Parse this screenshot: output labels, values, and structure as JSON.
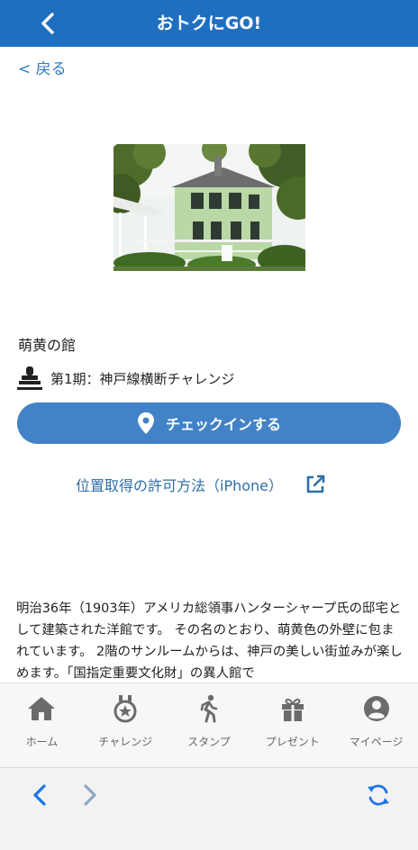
{
  "header": {
    "title": "おトクにGO!",
    "back_icon": "chevron-left-icon"
  },
  "back_link": {
    "label": "< 戻る"
  },
  "photo": {
    "icon": "house-photo"
  },
  "spot": {
    "name": "萌黄の館",
    "challenge_icon": "stamp-icon",
    "challenge": "第1期：神戸線横断チャレンジ"
  },
  "checkin": {
    "icon": "map-pin-icon",
    "label": "チェックインする"
  },
  "permission_link": {
    "label": "位置取得の許可方法（iPhone）",
    "icon": "external-link-icon"
  },
  "description": "明治36年（1903年）アメリカ総領事ハンターシャープ氏の邸宅として建築された洋館です。 その名のとおり、萌黄色の外壁に包まれています。 2階のサンルームからは、神戸の美しい街並みが楽しめます。「国指定重要文化財」の異人館で",
  "tabbar": {
    "items": [
      {
        "label": "ホーム",
        "icon": "home-icon"
      },
      {
        "label": "チャレンジ",
        "icon": "medal-icon"
      },
      {
        "label": "スタンプ",
        "icon": "walking-person-icon"
      },
      {
        "label": "プレゼント",
        "icon": "gift-icon"
      },
      {
        "label": "マイページ",
        "icon": "user-circle-icon"
      }
    ]
  },
  "browser": {
    "back_icon": "browser-back-icon",
    "forward_icon": "browser-forward-icon",
    "reload_icon": "reload-icon"
  },
  "colors": {
    "header_bg": "#1f6fc0",
    "link": "#2f7bc6",
    "button_bg": "#4282c7",
    "tab_icon": "#6b6b6b",
    "browser_active": "#1a73e8",
    "browser_inactive": "#8fa9c7"
  }
}
